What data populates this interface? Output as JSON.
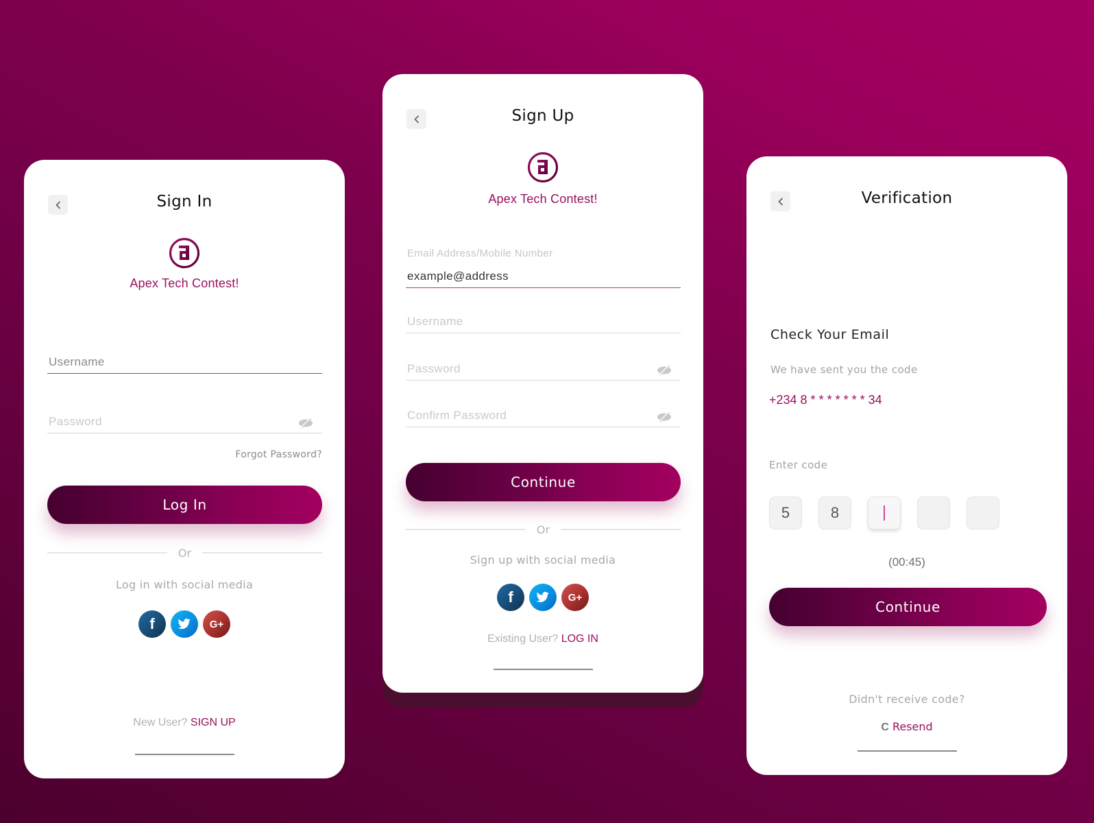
{
  "brand": {
    "name": "Apex Tech Contest!",
    "logo_icon": "apex-a-logo",
    "accent_color": "#9b0f5f",
    "button_gradient": [
      "#450030",
      "#a3005f"
    ]
  },
  "signin": {
    "back_icon": "chevron-left-icon",
    "title": "Sign In",
    "username_placeholder": "Username",
    "password_placeholder": "Password",
    "password_toggle_icon": "eye-off-icon",
    "forgot_password": "Forgot Password?",
    "login_button": "Log In",
    "divider": "Or",
    "social_text": "Log in with social media",
    "social": [
      {
        "name": "facebook",
        "icon": "facebook-icon",
        "glyph": "f"
      },
      {
        "name": "twitter",
        "icon": "twitter-icon",
        "glyph": ""
      },
      {
        "name": "google-plus",
        "icon": "google-plus-icon",
        "glyph": "G+"
      }
    ],
    "footer_prefix": "New User?",
    "footer_link": "SIGN UP"
  },
  "signup": {
    "back_icon": "chevron-left-icon",
    "title": "Sign Up",
    "email_label": "Email Address/Mobile Number",
    "email_value": "example@address",
    "username_placeholder": "Username",
    "password_placeholder": "Password",
    "confirm_password_placeholder": "Confirm Password",
    "continue_button": "Continue",
    "divider": "Or",
    "social_text": "Sign up with social media",
    "social": [
      {
        "name": "facebook",
        "icon": "facebook-icon",
        "glyph": "f"
      },
      {
        "name": "twitter",
        "icon": "twitter-icon",
        "glyph": ""
      },
      {
        "name": "google-plus",
        "icon": "google-plus-icon",
        "glyph": "G+"
      }
    ],
    "footer_prefix": "Existing User?",
    "footer_link": "LOG IN"
  },
  "verification": {
    "back_icon": "chevron-left-icon",
    "title": "Verification",
    "heading": "Check Your Email",
    "sent_text": "We have sent you the code",
    "masked_phone": "+234 8 * * * * * * * 34",
    "enter_code_label": "Enter code",
    "code_digits": [
      "5",
      "8",
      "",
      "",
      ""
    ],
    "focused_index": 2,
    "timer": "(00:45)",
    "continue_button": "Continue",
    "didnt_receive": "Didn't receive code?",
    "resend_icon": "refresh-icon",
    "resend_glyph": "C",
    "resend_label": "Resend"
  }
}
